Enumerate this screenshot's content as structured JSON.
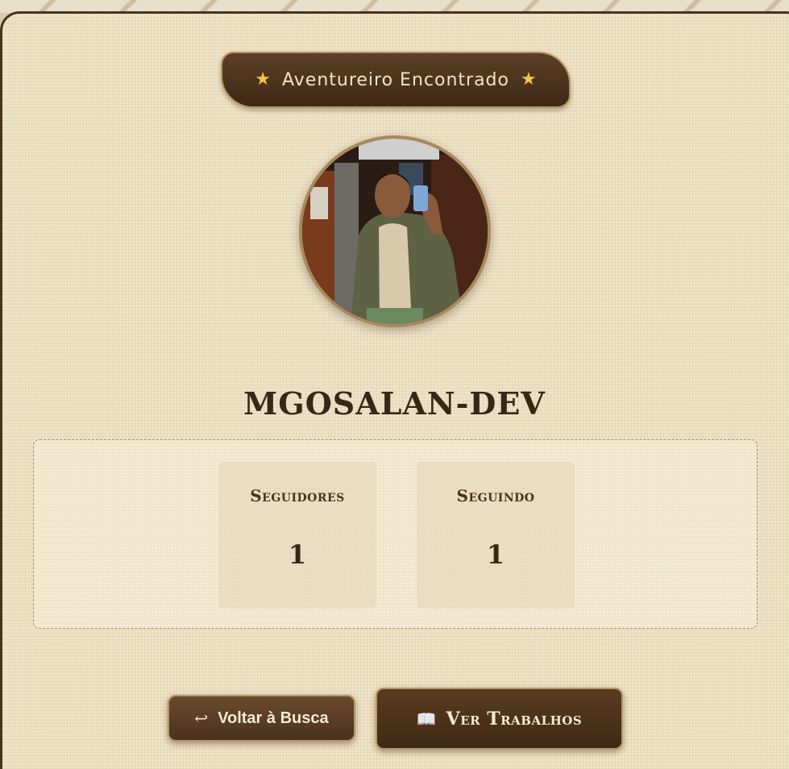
{
  "banner": {
    "star_left": "★",
    "title": "Aventureiro Encontrado",
    "star_right": "★"
  },
  "profile": {
    "username": "MGOSALAN-DEV"
  },
  "stats": [
    {
      "label": "Seguidores",
      "value": "1"
    },
    {
      "label": "Seguindo",
      "value": "1"
    }
  ],
  "actions": {
    "back": {
      "icon": "↩",
      "label": "Voltar à Busca"
    },
    "works": {
      "icon": "📖",
      "label": "Ver Trabalhos"
    }
  },
  "colors": {
    "dark_brown": "#3e2915",
    "gold_star": "#f4c542",
    "parchment": "#efe3c7",
    "border_gold": "#b89665"
  }
}
